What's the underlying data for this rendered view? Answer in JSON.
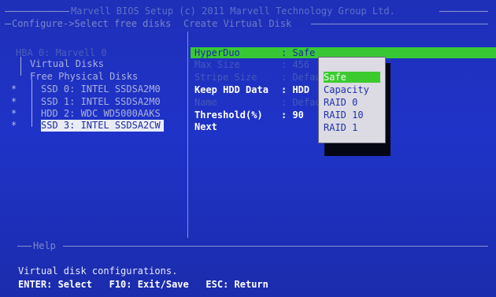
{
  "header": {
    "title": "Marvell BIOS Setup (c) 2011 Marvell Technology Group Ltd.",
    "breadcrumb": "Configure->Select free disks",
    "section": "Create Virtual Disk"
  },
  "tree": {
    "root": "HBA 0: Marvell 0",
    "virtual_disks": "Virtual Disks",
    "free_disks": "Free Physical Disks",
    "disks": [
      {
        "marker": "*",
        "label": "SSD 0: INTEL SSDSA2M0"
      },
      {
        "marker": "*",
        "label": "SSD 1: INTEL SSDSA2M0"
      },
      {
        "marker": "*",
        "label": "HDD 2: WDC WD5000AAKS"
      },
      {
        "marker": "*",
        "label": "SSD 3: INTEL SSDSA2CW"
      }
    ]
  },
  "form": {
    "hyperduo_label": "HyperDuo",
    "hyperduo_value": ": Safe",
    "max_size_label": "Max Size",
    "max_size_value": ": 456",
    "stripe_label": "Stripe Size",
    "stripe_value": ": Default",
    "keep_label": "Keep HDD Data",
    "keep_value": ": HDD",
    "name_label": "Name",
    "name_value": ": Default",
    "threshold_label": "Threshold(%)",
    "threshold_value": ": 90",
    "next_label": "Next"
  },
  "popup": {
    "options": [
      "Safe",
      "Capacity",
      "RAID 0",
      "RAID 10",
      "RAID 1"
    ],
    "selected": "Safe"
  },
  "help": {
    "label": "Help",
    "text": "Virtual disk configurations.",
    "keys": "ENTER: Select   F10: Exit/Save   ESC: Return"
  }
}
